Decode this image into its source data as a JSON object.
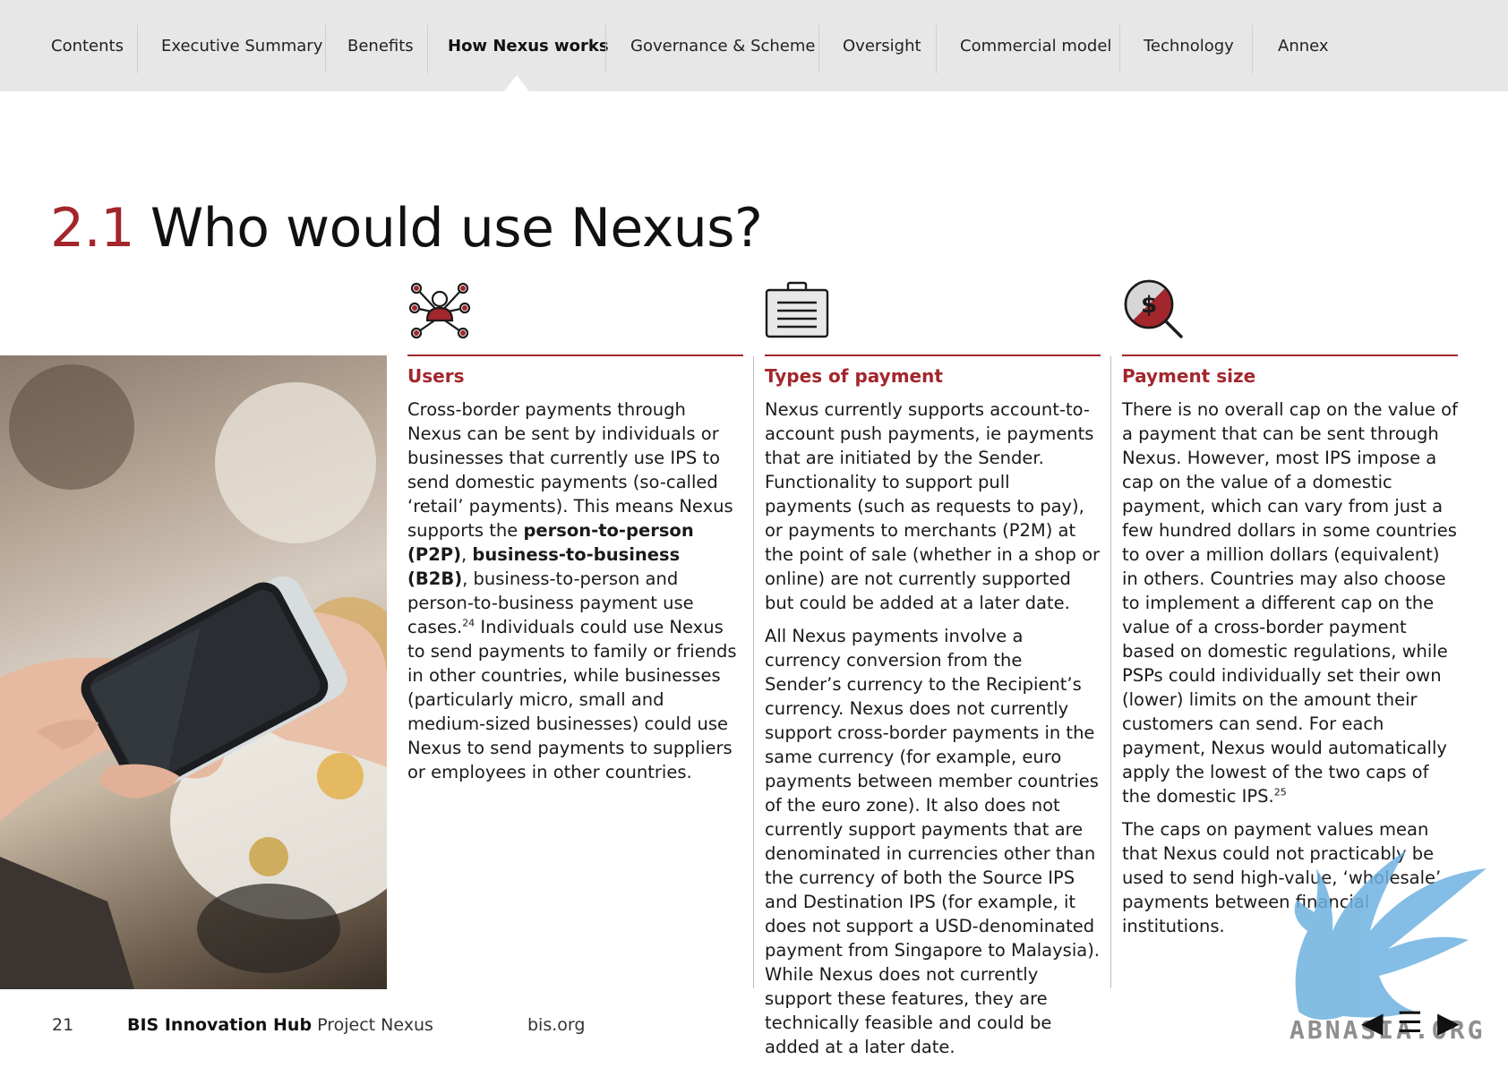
{
  "nav": {
    "items": [
      {
        "label": "Contents"
      },
      {
        "label": "Executive Summary"
      },
      {
        "label": "Benefits"
      },
      {
        "label": "How Nexus works",
        "active": true
      },
      {
        "label": "Governance & Scheme"
      },
      {
        "label": "Oversight"
      },
      {
        "label": "Commercial model"
      },
      {
        "label": "Technology"
      },
      {
        "label": "Annex"
      }
    ]
  },
  "page": {
    "section_number": "2.1",
    "title": "Who would use Nexus?"
  },
  "columns": {
    "users": {
      "icon": "network-user-icon",
      "heading": "Users",
      "p1_a": "Cross-border payments through Nexus can be sent by individuals or businesses that currently use IPS to send domestic payments (so-called ‘retail’ payments). This means Nexus supports the ",
      "p1_b1": "person-to-person (P2P)",
      "p1_c": ", ",
      "p1_b2": "business-to-business (B2B)",
      "p1_d": ", business-to-person and person-to-business payment use cases.",
      "p1_sup": "24",
      "p1_e": " Individuals could use Nexus to send payments to family or friends in other countries, while businesses (particularly micro, small and medium-sized businesses) could use Nexus to send payments to suppliers or employees in other countries."
    },
    "types": {
      "icon": "briefcase-list-icon",
      "heading": "Types of payment",
      "p1": "Nexus currently supports account-to-account push payments, ie payments that are initiated by the Sender. Functionality to support pull payments (such as requests to pay), or payments to merchants (P2M) at the point of sale (whether in a shop or online) are not currently supported but could be added at a later date.",
      "p2": "All Nexus payments involve a currency conversion from the Sender’s currency to the Recipient’s currency. Nexus does not currently support cross-border payments in the same currency (for example, euro payments between member countries of the euro zone). It also does not currently support payments that are denominated in currencies other than the currency of both the Source IPS and Destination IPS (for example, it does not support a USD-denominated payment from Singapore to Malaysia). While Nexus does not currently support these features, they are technically feasible and could be added at a later date."
    },
    "size": {
      "icon": "dollar-magnifier-icon",
      "heading": "Payment size",
      "p1": "There is no overall cap on the value of a payment that can be sent through Nexus. However, most IPS impose a cap on the value of a domestic payment, which can vary from just a few hundred dollars in some countries to over a million dollars (equivalent) in others. Countries may also choose to implement a different cap on the value of a cross-border payment based on domestic regulations, while PSPs could individually set their own (lower) limits on the amount their customers can send. For each payment, Nexus would automatically apply the lowest of the two caps of the domestic IPS.",
      "p1_sup": "25",
      "p2": "The caps on payment values mean that Nexus could not practicably be used to send high-value, ‘wholesale’ payments between financial institutions."
    }
  },
  "footer": {
    "page_number": "21",
    "publisher": "BIS Innovation Hub",
    "project": "Project Nexus",
    "site": "bis.org"
  },
  "watermark": {
    "text": "ABNASIA.ORG"
  },
  "colors": {
    "accent": "#a3262c",
    "nav_bg": "#e7e7e7"
  }
}
